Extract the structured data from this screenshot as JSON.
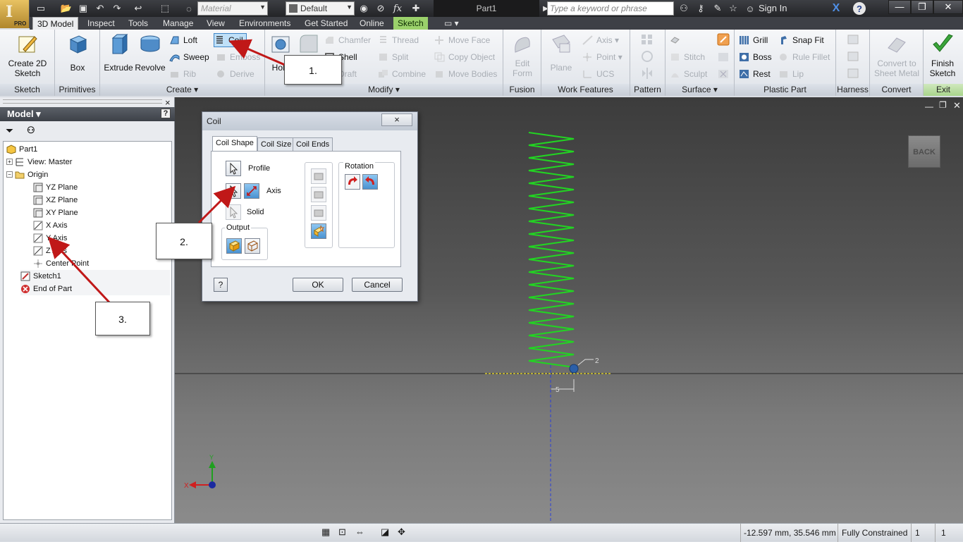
{
  "titlebar": {
    "app_edition": "PRO",
    "material_placeholder": "Material",
    "appearance_value": "Default",
    "document_title": "Part1",
    "search_placeholder": "Type a keyword or phrase",
    "sign_in": "Sign In",
    "help": "?",
    "fx": "fx"
  },
  "tabs": [
    {
      "label": "3D Model"
    },
    {
      "label": "Inspect"
    },
    {
      "label": "Tools"
    },
    {
      "label": "Manage"
    },
    {
      "label": "View"
    },
    {
      "label": "Environments"
    },
    {
      "label": "Get Started"
    },
    {
      "label": "Online"
    },
    {
      "label": "Sketch"
    }
  ],
  "ribbon": {
    "sketch": {
      "create_2d_sketch": "Create 2D Sketch",
      "panel": "Sketch"
    },
    "primitives": {
      "box": "Box",
      "panel": "Primitives"
    },
    "create": {
      "extrude": "Extrude",
      "revolve": "Revolve",
      "loft": "Loft",
      "sweep": "Sweep",
      "rib": "Rib",
      "coil": "Coil",
      "emboss": "Emboss",
      "derive": "Derive",
      "panel": "Create ▾"
    },
    "modify": {
      "hole": "Hole",
      "chamfer": "Chamfer",
      "shell": "Shell",
      "draft": "Draft",
      "thread": "Thread",
      "split": "Split",
      "combine": "Combine",
      "move_face": "Move Face",
      "copy_object": "Copy Object",
      "move_bodies": "Move Bodies",
      "panel": "Modify ▾"
    },
    "fusion": {
      "edit_form": "Edit Form",
      "panel": "Fusion"
    },
    "work_features": {
      "plane": "Plane",
      "axis": "Axis",
      "point": "Point",
      "ucs": "UCS",
      "panel": "Work Features"
    },
    "pattern": {
      "panel": "Pattern"
    },
    "surface": {
      "stitch": "Stitch",
      "sculpt": "Sculpt",
      "panel": "Surface ▾"
    },
    "plastic_part": {
      "grill": "Grill",
      "boss": "Boss",
      "rest": "Rest",
      "snap_fit": "Snap Fit",
      "rule_fillet": "Rule Fillet",
      "lip": "Lip",
      "panel": "Plastic Part"
    },
    "harness": {
      "panel": "Harness"
    },
    "convert": {
      "convert_to_sheet_metal": "Convert to Sheet Metal",
      "panel": "Convert"
    },
    "exit": {
      "finish_sketch": "Finish Sketch",
      "panel": "Exit"
    }
  },
  "browser": {
    "title": "Model ▾",
    "help": "?",
    "close": "×",
    "tree": [
      {
        "label": "Part1",
        "icon": "part-icon"
      },
      {
        "label": "View: Master",
        "icon": "view-icon"
      },
      {
        "label": "Origin",
        "icon": "folder-icon"
      },
      {
        "label": "YZ Plane",
        "icon": "plane-icon"
      },
      {
        "label": "XZ Plane",
        "icon": "plane-icon"
      },
      {
        "label": "XY Plane",
        "icon": "plane-icon"
      },
      {
        "label": "X Axis",
        "icon": "axis-icon"
      },
      {
        "label": "Y Axis",
        "icon": "axis-icon"
      },
      {
        "label": "Z Axis",
        "icon": "axis-icon"
      },
      {
        "label": "Center Point",
        "icon": "point-icon"
      },
      {
        "label": "Sketch1",
        "icon": "sketch-icon"
      },
      {
        "label": "End of Part",
        "icon": "end-of-part-icon"
      }
    ]
  },
  "dialog": {
    "title": "Coil",
    "close": "×",
    "tabs": [
      "Coil Shape",
      "Coil Size",
      "Coil Ends"
    ],
    "profile": "Profile",
    "axis": "Axis",
    "solid": "Solid",
    "output": "Output",
    "rotation": "Rotation",
    "help": "?",
    "ok": "OK",
    "cancel": "Cancel"
  },
  "callouts": [
    "1.",
    "2.",
    "3."
  ],
  "viewport": {
    "back_button": "BACK",
    "dimension_small": "2",
    "dimension_bottom": "5",
    "triad_x": "X",
    "triad_y": "Y"
  },
  "statusbar": {
    "coordinates": "-12.597 mm, 35.546 mm",
    "constraint_status": "Fully Constrained",
    "count_a": "1",
    "count_b": "1"
  },
  "colors": {
    "accent_arrow": "#c01818",
    "coil_green": "#22d422",
    "sketch_tab": "#9bd16b"
  }
}
